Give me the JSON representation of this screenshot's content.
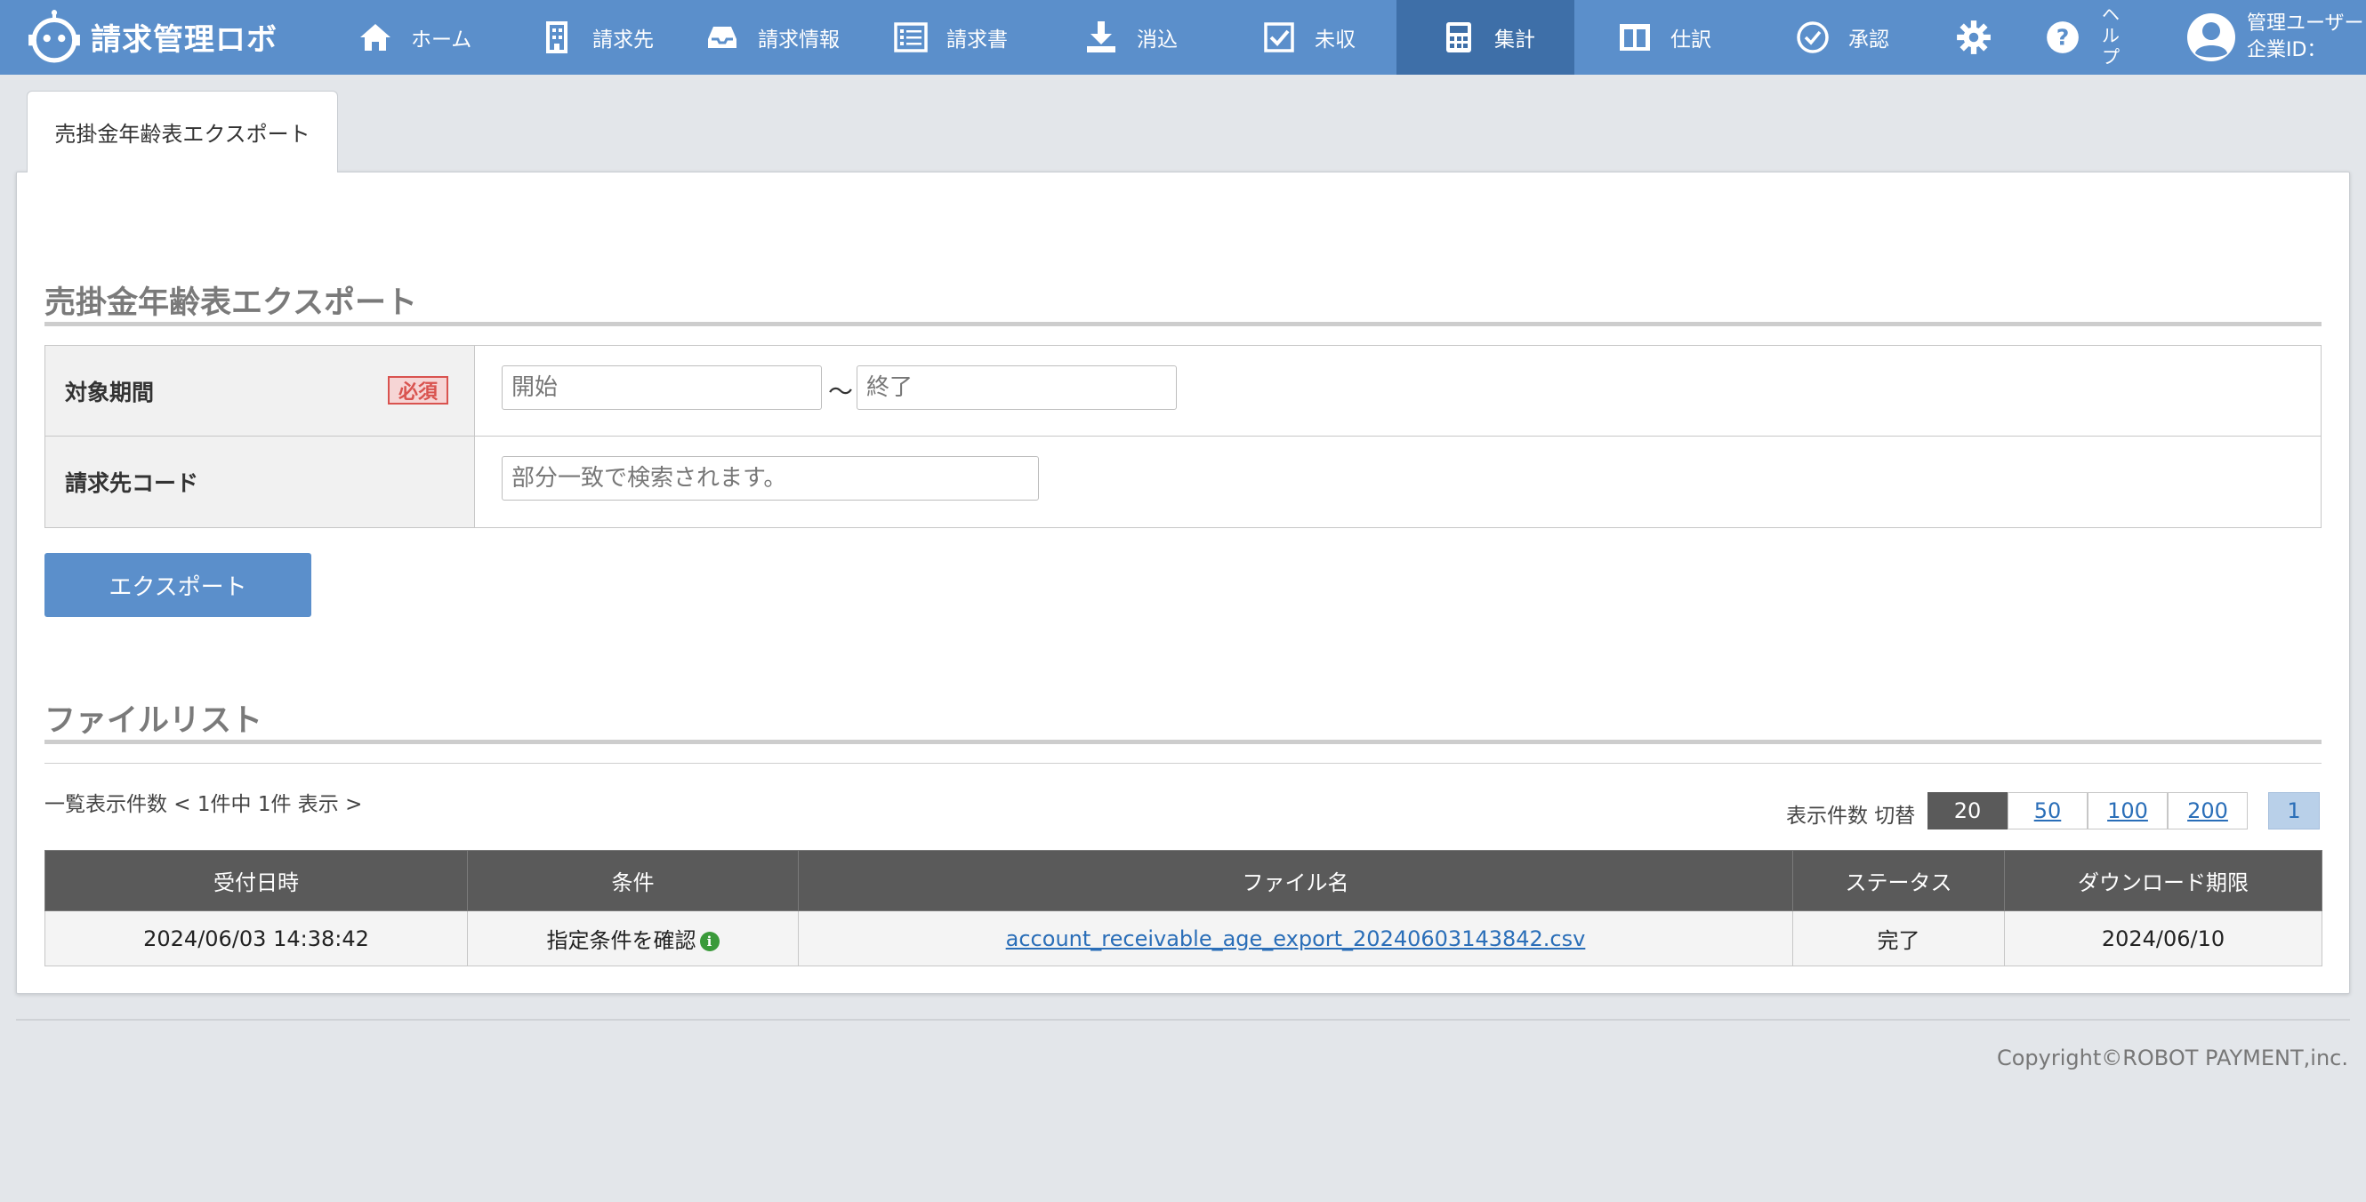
{
  "app": {
    "name": "請求管理ロボ"
  },
  "nav": {
    "home": "ホーム",
    "customers": "請求先",
    "billing_info": "請求情報",
    "invoices": "請求書",
    "reconcile": "消込",
    "unpaid": "未収",
    "summary": "集計",
    "journal": "仕訳",
    "approval": "承認",
    "help": "ヘルプ"
  },
  "user": {
    "name": "管理ユーザー",
    "company_id": "企業ID："
  },
  "tab": {
    "label": "売掛金年齢表エクスポート"
  },
  "export_section": {
    "title": "売掛金年齢表エクスポート",
    "period_label": "対象期間",
    "required_badge": "必須",
    "start_placeholder": "開始",
    "tilde": "〜",
    "end_placeholder": "終了",
    "customer_code_label": "請求先コード",
    "customer_code_placeholder": "部分一致で検索されます。",
    "export_button": "エクスポート"
  },
  "file_list": {
    "title": "ファイルリスト",
    "count_text": "一覧表示件数 < 1件中 1件 表示 >",
    "per_page_label": "表示件数 切替",
    "per_page_options": [
      "20",
      "50",
      "100",
      "200"
    ],
    "current_page": "1",
    "columns": [
      "受付日時",
      "条件",
      "ファイル名",
      "ステータス",
      "ダウンロード期限"
    ],
    "rows": [
      {
        "received_at": "2024/06/03 14:38:42",
        "condition": "指定条件を確認",
        "file_name": "account_receivable_age_export_20240603143842.csv",
        "status": "完了",
        "expires": "2024/06/10"
      }
    ]
  },
  "footer": {
    "copyright": "Copyright©ROBOT PAYMENT,inc."
  }
}
